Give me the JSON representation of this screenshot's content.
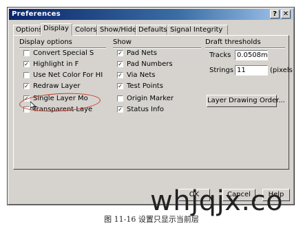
{
  "window": {
    "title": "Preferences",
    "help_label": "?",
    "close_label": "✕"
  },
  "tabs": [
    {
      "label": "Options"
    },
    {
      "label": "Display",
      "active": true
    },
    {
      "label": "Colors"
    },
    {
      "label": "Show/Hide"
    },
    {
      "label": "Defaults"
    },
    {
      "label": "Signal Integrity"
    }
  ],
  "display_options": {
    "title": "Display options",
    "items": [
      {
        "label": "Convert Special S",
        "checked": false,
        "mark": ""
      },
      {
        "label": "Highlight in F",
        "checked": true,
        "mark": "✓"
      },
      {
        "label": "Use Net Color For HI",
        "checked": false,
        "mark": ""
      },
      {
        "label": "Redraw Layer",
        "checked": true,
        "mark": "✓"
      },
      {
        "label": "Single Layer Mo",
        "checked": true,
        "mark": "✓"
      },
      {
        "label": "Transparent Laye",
        "checked": false,
        "mark": ""
      }
    ]
  },
  "show": {
    "title": "Show",
    "items": [
      {
        "label": "Pad Nets",
        "checked": true,
        "mark": "✓"
      },
      {
        "label": "Pad Numbers",
        "checked": true,
        "mark": "✓"
      },
      {
        "label": "Via Nets",
        "checked": true,
        "mark": "✓"
      },
      {
        "label": "Test Points",
        "checked": true,
        "mark": "✓"
      },
      {
        "label": "Origin Marker",
        "checked": false,
        "mark": ""
      },
      {
        "label": "Status Info",
        "checked": true,
        "mark": "✓"
      }
    ]
  },
  "draft_thresholds": {
    "title": "Draft thresholds",
    "tracks_label": "Tracks",
    "tracks_value": "0.0508mm",
    "strings_label": "Strings",
    "strings_value": "11",
    "strings_unit": "(pixels",
    "layer_order_button": "Layer Drawing Order..."
  },
  "buttons": {
    "ok": "OK",
    "cancel": "Cancel",
    "help": "Help"
  },
  "watermark": "whjqjx.co",
  "caption": "图 11-16    设置只显示当前层",
  "colors": {
    "titlebar_start": "#0a246a",
    "dialog_face": "#d6d3ce",
    "annotation": "#c0392b"
  }
}
